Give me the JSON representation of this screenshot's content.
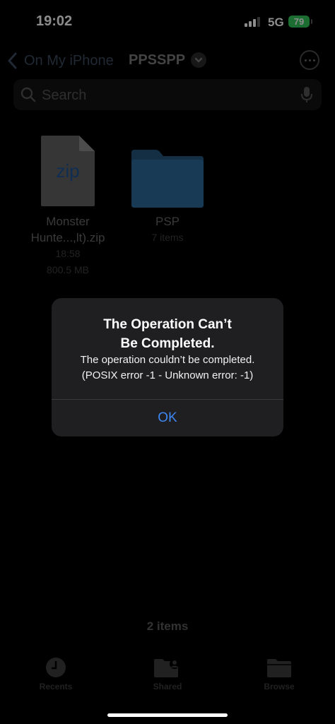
{
  "status_bar": {
    "time": "19:02",
    "network": "5G",
    "battery": "79"
  },
  "nav": {
    "back_label": "On My iPhone",
    "title": "PPSSPP"
  },
  "search": {
    "placeholder": "Search"
  },
  "files": [
    {
      "icon_label": "zip",
      "name_line1": "Monster",
      "name_line2": "Hunte...,lt).zip",
      "time": "18:58",
      "size": "800.5 MB"
    },
    {
      "name": "PSP",
      "meta": "7 items"
    }
  ],
  "alert": {
    "title_line1": "The Operation Can’t",
    "title_line2": "Be Completed.",
    "message_line1": "The operation couldn’t be completed.",
    "message_line2": "(POSIX error -1 - Unknown error: -1)",
    "ok_label": "OK"
  },
  "footer": {
    "count": "2 items"
  },
  "tab_bar": {
    "recents": "Recents",
    "shared": "Shared",
    "browse": "Browse"
  },
  "colors": {
    "accent": "#3e86f0",
    "battery": "#33c759",
    "folder": "#2e6a9a"
  }
}
